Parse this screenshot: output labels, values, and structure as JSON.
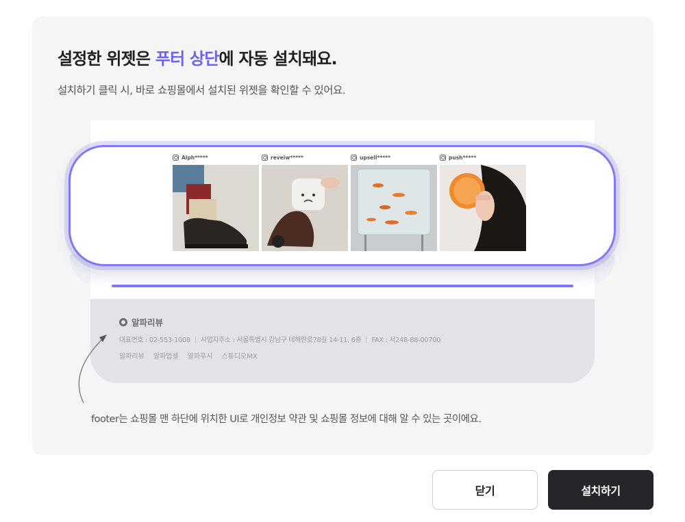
{
  "title": {
    "prefix": "설정한 위젯은 ",
    "highlight": "푸터 상단",
    "suffix": "에 자동 설치돼요."
  },
  "subtitle": "설치하기 클릭 시, 바로 쇼핑몰에서 설치된 위젯을 확인할 수 있어요.",
  "widget": {
    "items": [
      {
        "handle": "Alph*****"
      },
      {
        "handle": "reveiw*****"
      },
      {
        "handle": "upsell*****"
      },
      {
        "handle": "push*****"
      }
    ]
  },
  "footer": {
    "brand": "알파리뷰",
    "phone": "대표번호 : 02-553-1008",
    "address": "사업자주소 : 서울특별시 강남구 테헤란로78길 14-11, 6층",
    "fax": "FAX : 서248-88-00700",
    "links": [
      "알파리뷰",
      "알파업셀",
      "알파푸시",
      "스튜디오MX"
    ]
  },
  "caption": "footer는 쇼핑몰 맨 하단에 위치한 UI로 개인정보 약관 및 쇼핑몰 정보에 대해 알 수 있는 곳이에요.",
  "buttons": {
    "close": "닫기",
    "install": "설치하기"
  },
  "colors": {
    "accent": "#6b63ee",
    "widget_border": "#8079f2",
    "primary_button": "#26262a",
    "card_bg": "#f5f5f6"
  }
}
